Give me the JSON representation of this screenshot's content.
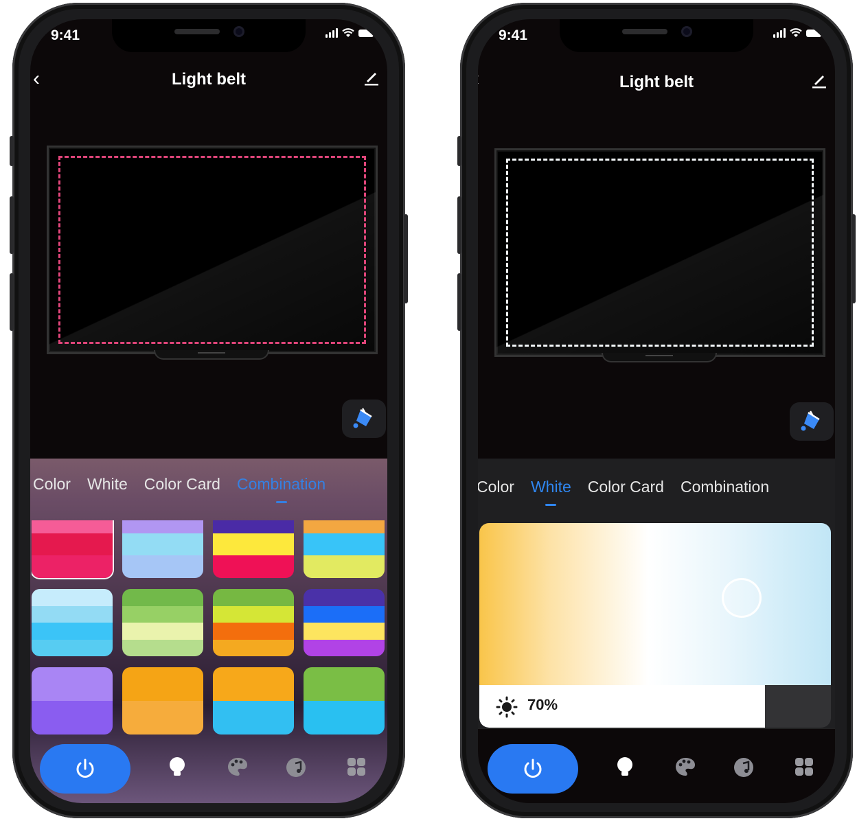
{
  "phones": [
    {
      "status_time": "9:41",
      "title": "Light belt",
      "tabs": [
        "Color",
        "White",
        "Color Card",
        "Combination"
      ],
      "active_tab": "Combination",
      "strip_color": "#e0457a",
      "palette_grid": [
        [
          "#f55c97",
          "#e5194e",
          "#ec2266"
        ],
        [
          "#b196f2",
          "#93dcf4",
          "#a6c6f6"
        ],
        [
          "#4a2ba6",
          "#fde83c",
          "#ef1156"
        ],
        [
          "#f3a741",
          "#38c4f8",
          "#e2ea61"
        ],
        [
          "#c6ecfc",
          "#93dbf4",
          "#3bc4f7",
          "#57ccf2"
        ],
        [
          "#72b94a",
          "#97d065",
          "#eaf3ad",
          "#b5dd8d"
        ],
        [
          "#76b842",
          "#d5e636",
          "#f36e0d",
          "#f4a920"
        ],
        [
          "#4a31a8",
          "#1b6ef8",
          "#fde55f",
          "#b143e6"
        ],
        [
          "#a985f4",
          "#8a5df0"
        ],
        [
          "#f5a415",
          "#f6ac3c"
        ],
        [
          "#f7a81a",
          "#32bff2"
        ],
        [
          "#7abe45",
          "#29c0f1"
        ]
      ]
    },
    {
      "status_time": "9:41",
      "title": "Light belt",
      "tabs": [
        "Color",
        "White",
        "Color Card",
        "Combination"
      ],
      "active_tab": "White",
      "strip_color": "#f2f6f8",
      "brightness_label": "70%",
      "brightness_value": 70,
      "warmth_position": 0.74
    }
  ],
  "nav_icons": [
    "power-icon",
    "bulb-icon",
    "palette-icon",
    "music-icon",
    "grid-icon"
  ]
}
